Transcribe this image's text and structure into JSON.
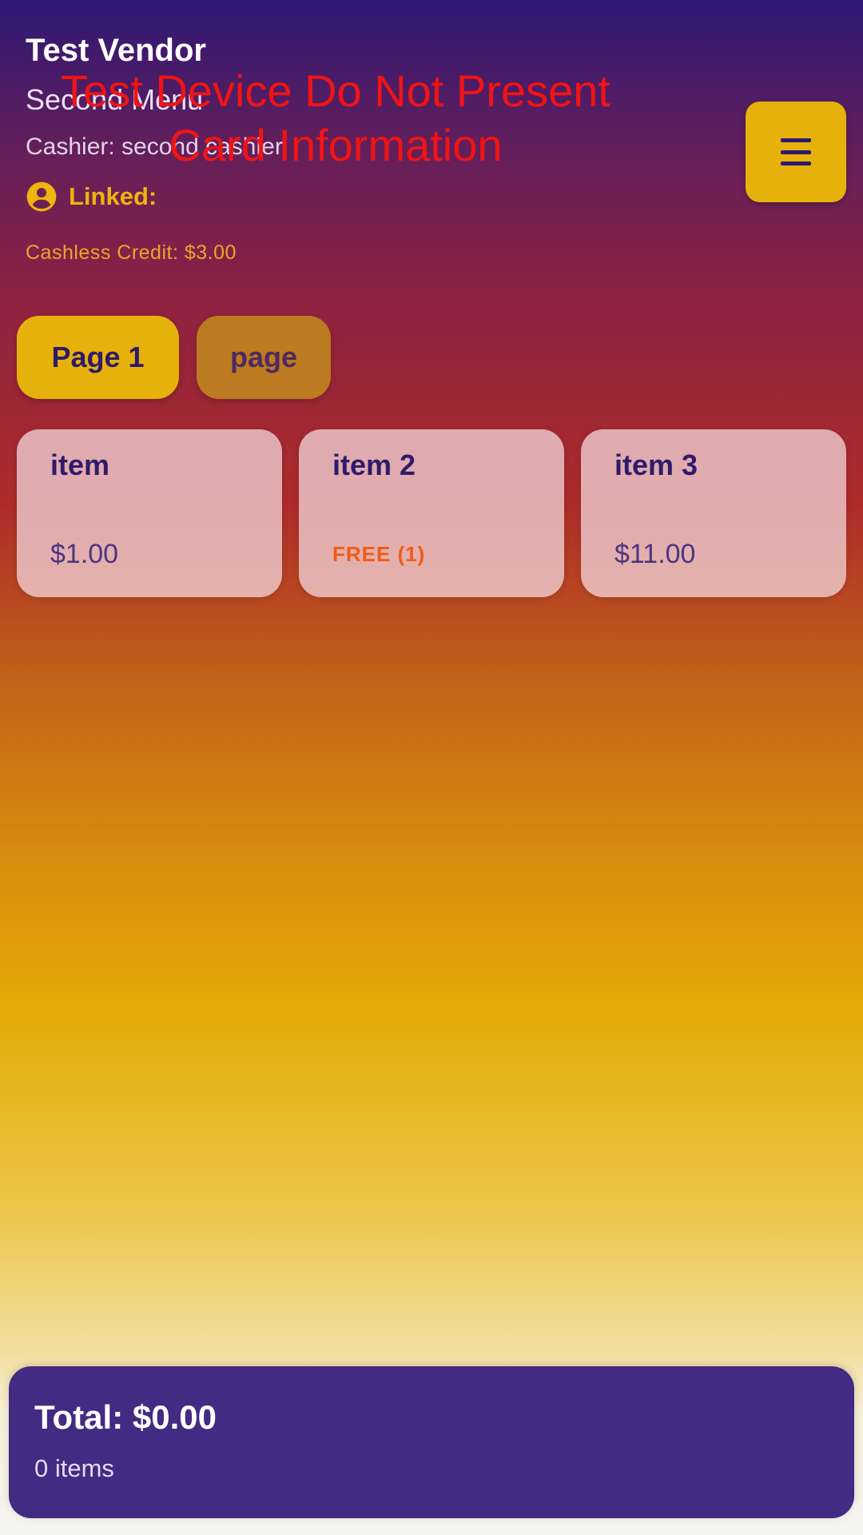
{
  "header": {
    "vendor_name": "Test Vendor",
    "menu_name": "Second Menu",
    "cashier": "Cashier: second cashier",
    "linked_label": "Linked:",
    "linked_icon": "account-circle-icon",
    "cashless_credit": "Cashless Credit: $3.00"
  },
  "test_banner": "Test Device Do Not Present Card Information",
  "menu_button": {
    "icon": "hamburger-menu-icon"
  },
  "tabs": [
    {
      "label": "Page 1",
      "active": true
    },
    {
      "label": "page",
      "active": false
    }
  ],
  "items": [
    {
      "name": "item",
      "price": "$1.00"
    },
    {
      "name": "item 2",
      "price": "FREE (1)"
    },
    {
      "name": "item 3",
      "price": "$11.00"
    }
  ],
  "footer": {
    "total": "Total: $0.00",
    "item_count": "0 items"
  },
  "colors": {
    "accent_yellow": "#e6b10a",
    "deep_purple": "#2f1a6b",
    "panel_purple": "#432a82",
    "free_orange": "#f15a17",
    "banner_red": "#f01414"
  }
}
